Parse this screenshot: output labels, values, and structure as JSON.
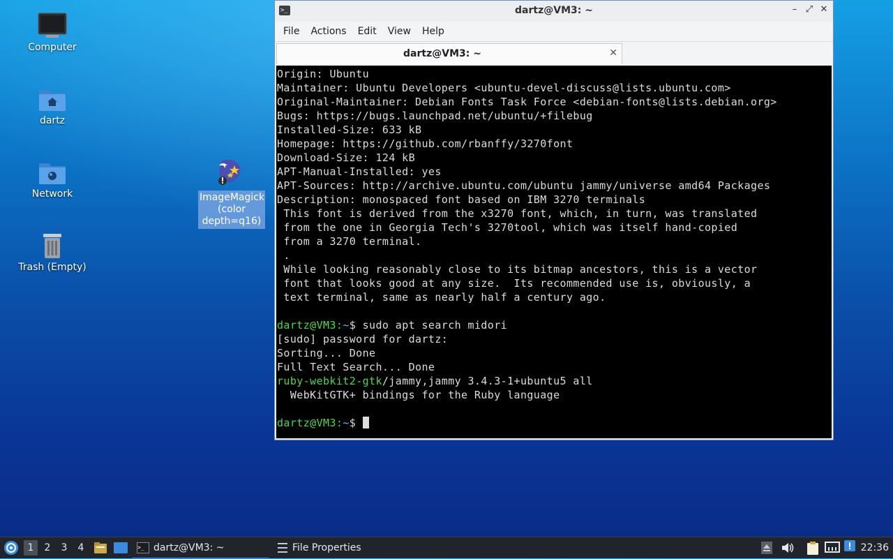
{
  "desktop": {
    "icons": [
      {
        "label": "Computer"
      },
      {
        "label": "dartz"
      },
      {
        "label": "Network"
      },
      {
        "label": "Trash (Empty)"
      }
    ],
    "selected_icon": {
      "label_lines": [
        "ImageMagick",
        "(color",
        "depth=q16)"
      ]
    }
  },
  "window": {
    "title": "dartz@VM3: ~",
    "controls": {
      "minimize": "–",
      "maximize": "⤢",
      "close": "✕"
    },
    "menu": [
      "File",
      "Actions",
      "Edit",
      "View",
      "Help"
    ],
    "tab": {
      "label": "dartz@VM3: ~",
      "close": "✕"
    }
  },
  "terminal": {
    "lines": [
      "Origin: Ubuntu",
      "Maintainer: Ubuntu Developers <ubuntu-devel-discuss@lists.ubuntu.com>",
      "Original-Maintainer: Debian Fonts Task Force <debian-fonts@lists.debian.org>",
      "Bugs: https://bugs.launchpad.net/ubuntu/+filebug",
      "Installed-Size: 633 kB",
      "Homepage: https://github.com/rbanffy/3270font",
      "Download-Size: 124 kB",
      "APT-Manual-Installed: yes",
      "APT-Sources: http://archive.ubuntu.com/ubuntu jammy/universe amd64 Packages",
      "Description: monospaced font based on IBM 3270 terminals",
      " This font is derived from the x3270 font, which, in turn, was translated",
      " from the one in Georgia Tech's 3270tool, which was itself hand-copied",
      " from a 3270 terminal.",
      " .",
      " While looking reasonably close to its bitmap ancestors, this is a vector",
      " font that looks good at any size.  Its recommended use is, obviously, a",
      " text terminal, same as nearly half a century ago.",
      ""
    ],
    "prompt_user": "dartz@VM3:",
    "prompt_path": "~",
    "prompt_sign": "$",
    "command": " sudo apt search midori",
    "output": [
      "[sudo] password for dartz:",
      "Sorting... Done",
      "Full Text Search... Done"
    ],
    "result_pkg": "ruby-webkit2-gtk",
    "result_rest": "/jammy,jammy 3.4.3-1+ubuntu5 all",
    "result_desc": "  WebKitGTK+ bindings for the Ruby language",
    "blank": ""
  },
  "taskbar": {
    "workspaces": [
      "1",
      "2",
      "3",
      "4"
    ],
    "tasks": [
      {
        "label": "dartz@VM3: ~"
      },
      {
        "label": "File Properties"
      }
    ],
    "clock": "22:36"
  }
}
